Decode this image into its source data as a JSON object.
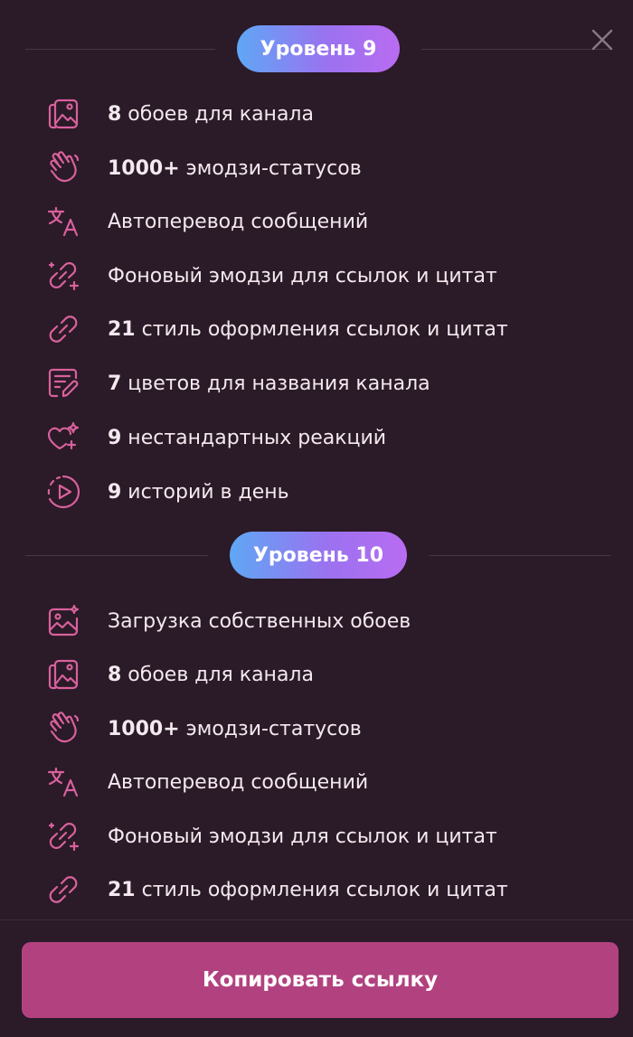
{
  "levels": [
    {
      "title": "Уровень 9",
      "items": [
        {
          "icon": "wallpaper-icon",
          "bold": "8",
          "text": " обоев для канала"
        },
        {
          "icon": "hand-wave-icon",
          "bold": "1000+",
          "text": " эмодзи-статусов"
        },
        {
          "icon": "translate-icon",
          "bold": "",
          "text": "Автоперевод сообщений"
        },
        {
          "icon": "link-sparkle-icon",
          "bold": "",
          "text": "Фоновый эмодзи для ссылок и цитат"
        },
        {
          "icon": "link-icon",
          "bold": "21",
          "text": " стиль оформления ссылок и цитат"
        },
        {
          "icon": "edit-name-icon",
          "bold": "7",
          "text": " цветов для названия канала"
        },
        {
          "icon": "heart-sparkle-icon",
          "bold": "9",
          "text": " нестандартных реакций"
        },
        {
          "icon": "story-play-icon",
          "bold": "9",
          "text": " историй в день"
        }
      ]
    },
    {
      "title": "Уровень 10",
      "items": [
        {
          "icon": "custom-wallpaper-icon",
          "bold": "",
          "text": "Загрузка собственных обоев"
        },
        {
          "icon": "wallpaper-icon",
          "bold": "8",
          "text": " обоев для канала"
        },
        {
          "icon": "hand-wave-icon",
          "bold": "1000+",
          "text": " эмодзи-статусов"
        },
        {
          "icon": "translate-icon",
          "bold": "",
          "text": "Автоперевод сообщений"
        },
        {
          "icon": "link-sparkle-icon",
          "bold": "",
          "text": "Фоновый эмодзи для ссылок и цитат"
        },
        {
          "icon": "link-icon",
          "bold": "21",
          "text": " стиль оформления ссылок и цитат"
        }
      ]
    }
  ],
  "button": {
    "label": "Копировать ссылку"
  },
  "colors": {
    "background": "#2b1a27",
    "icon": "#d8619d",
    "button": "#b2427f",
    "pill_gradient_start": "#5fa7f5",
    "pill_gradient_end": "#b96cf1"
  }
}
